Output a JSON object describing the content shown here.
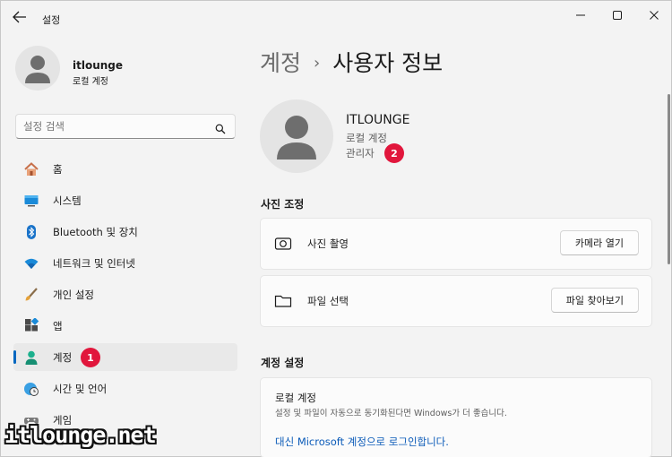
{
  "window": {
    "title": "설정"
  },
  "sidebar": {
    "profile": {
      "name": "itlounge",
      "type": "로컬 계정"
    },
    "search": {
      "placeholder": "설정 검색"
    },
    "items": [
      {
        "label": "홈",
        "icon": "home-icon"
      },
      {
        "label": "시스템",
        "icon": "system-icon"
      },
      {
        "label": "Bluetooth 및 장치",
        "icon": "bluetooth-icon"
      },
      {
        "label": "네트워크 및 인터넷",
        "icon": "wifi-icon"
      },
      {
        "label": "개인 설정",
        "icon": "brush-icon"
      },
      {
        "label": "앱",
        "icon": "apps-icon"
      },
      {
        "label": "계정",
        "icon": "account-icon",
        "active": true,
        "badge": "1"
      },
      {
        "label": "시간 및 언어",
        "icon": "clock-globe-icon"
      },
      {
        "label": "게임",
        "icon": "gamepad-icon"
      }
    ]
  },
  "main": {
    "breadcrumb": {
      "parent": "계정",
      "separator": "›",
      "current": "사용자 정보"
    },
    "user": {
      "name": "ITLOUNGE",
      "account_type": "로컬 계정",
      "role": "관리자",
      "badge": "2"
    },
    "photo_section": {
      "title": "사진 조정",
      "rows": [
        {
          "label": "사진 촬영",
          "button": "카메라 열기",
          "icon": "camera-icon"
        },
        {
          "label": "파일 선택",
          "button": "파일 찾아보기",
          "icon": "folder-icon"
        }
      ]
    },
    "account_section": {
      "title": "계정 설정",
      "card_title": "로컬 계정",
      "description": "설정 및 파일이 자동으로 동기화된다면 Windows가 더 좋습니다.",
      "link": "대신 Microsoft 계정으로 로그인합니다."
    }
  },
  "watermark": "itlounge.net",
  "colors": {
    "accent": "#0067c0",
    "badge": "#e1163c",
    "link": "#0a5ab8",
    "background": "#f3f3f3"
  }
}
